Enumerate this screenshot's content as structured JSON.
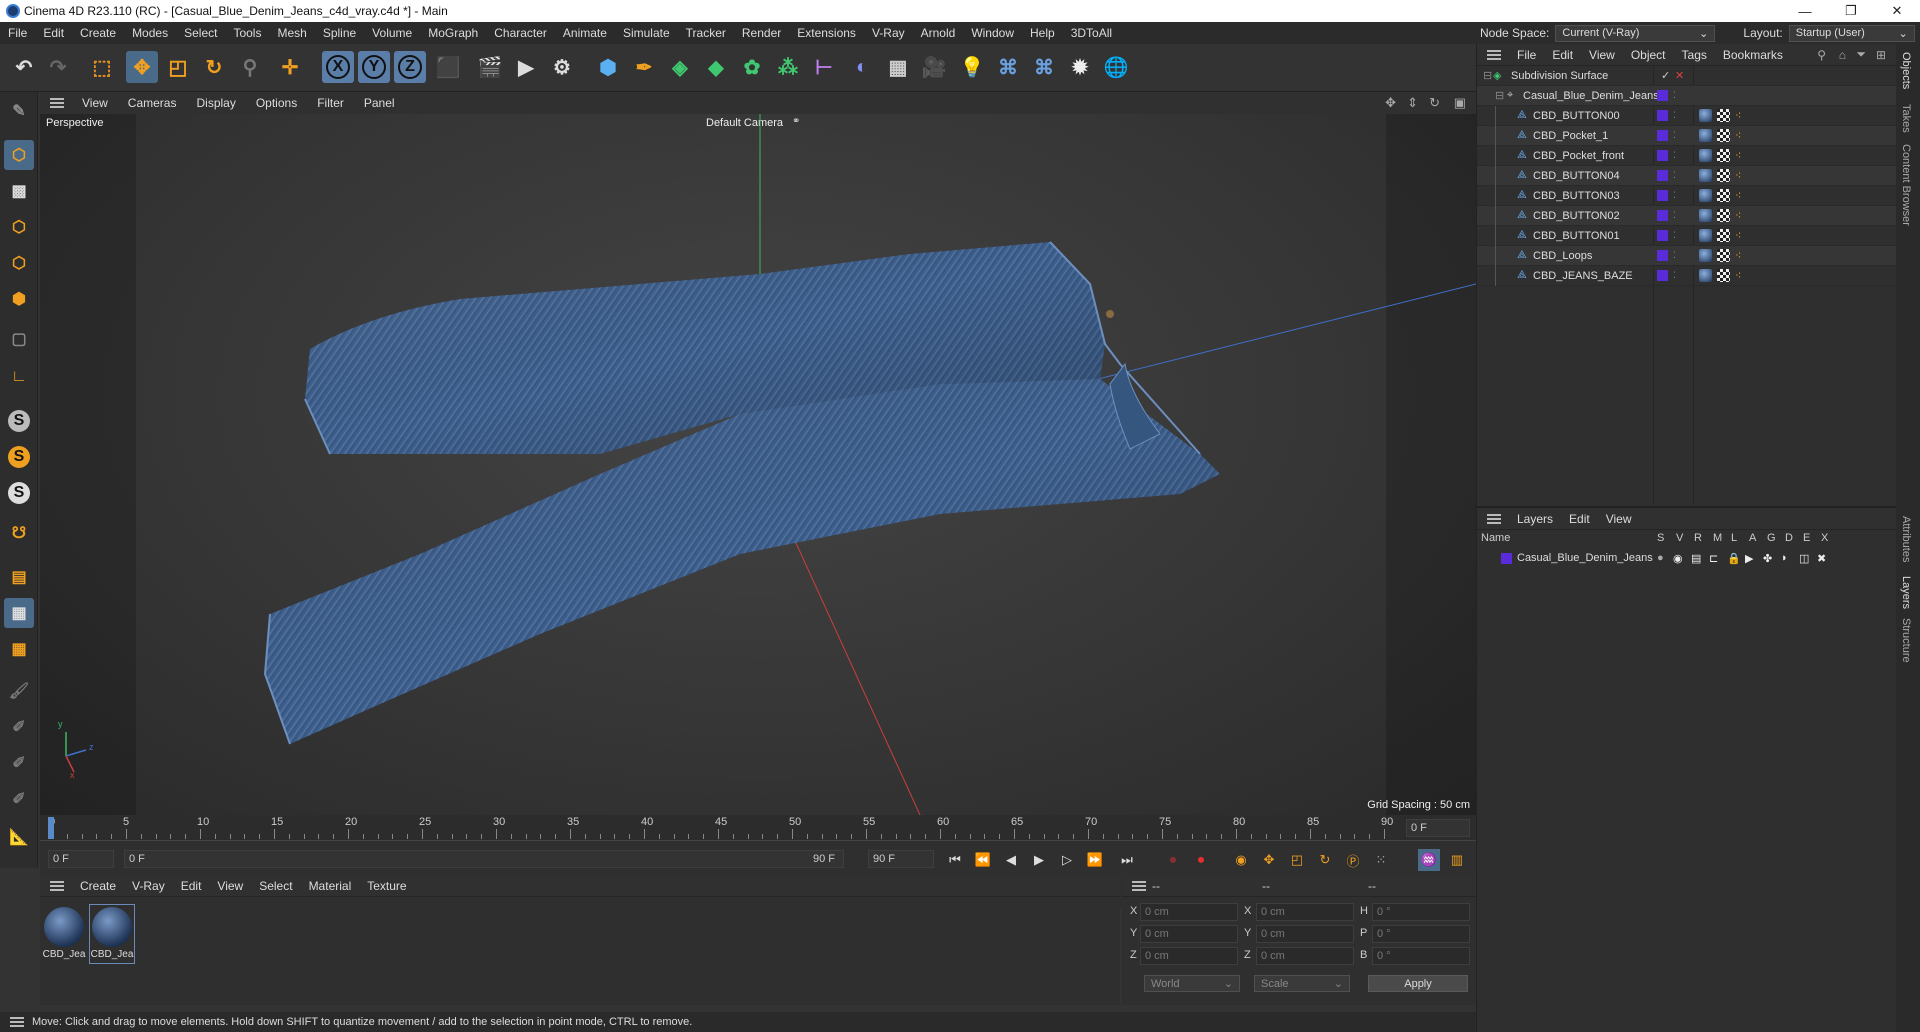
{
  "window": {
    "title": "Cinema 4D R23.110 (RC) - [Casual_Blue_Denim_Jeans_c4d_vray.c4d *] - Main",
    "minimize": "—",
    "restore": "❐",
    "close": "✕"
  },
  "menubar": {
    "items": [
      "File",
      "Edit",
      "Create",
      "Modes",
      "Select",
      "Tools",
      "Mesh",
      "Spline",
      "Volume",
      "MoGraph",
      "Character",
      "Animate",
      "Simulate",
      "Tracker",
      "Render",
      "Extensions",
      "V-Ray",
      "Arnold",
      "Window",
      "Help",
      "3DToAll"
    ],
    "node_space_label": "Node Space:",
    "node_space_value": "Current (V-Ray)",
    "layout_label": "Layout:",
    "layout_value": "Startup (User)"
  },
  "toolbar": {
    "axis_x": "X",
    "axis_y": "Y",
    "axis_z": "Z"
  },
  "viewport": {
    "menu": [
      "View",
      "Cameras",
      "Display",
      "Options",
      "Filter",
      "Panel"
    ],
    "view_name": "Perspective",
    "camera_name": "Default Camera",
    "grid_spacing": "Grid Spacing : 50 cm",
    "axis_y": "y",
    "axis_z": "z",
    "axis_x": "x",
    "accent_colors": {
      "x_axis": "#c84040",
      "y_axis": "#3cb860",
      "z_axis": "#4070c8"
    }
  },
  "timeline": {
    "ticks": [
      "0",
      "5",
      "10",
      "15",
      "20",
      "25",
      "30",
      "35",
      "40",
      "45",
      "50",
      "55",
      "60",
      "65",
      "70",
      "75",
      "80",
      "85",
      "90"
    ],
    "current_frame_display": "0 F",
    "start_frame": "0 F",
    "range_start": "0 F",
    "range_end": "90 F",
    "end_frame": "90 F"
  },
  "materials": {
    "menu": [
      "Create",
      "V-Ray",
      "Edit",
      "View",
      "Select",
      "Material",
      "Texture"
    ],
    "items": [
      {
        "label": "CBD_Jea"
      },
      {
        "label": "CBD_Jea"
      }
    ]
  },
  "coordinates": {
    "headers": [
      "--",
      "--",
      "--"
    ],
    "rows": [
      {
        "a_label": "X",
        "a_value": "0 cm",
        "b_label": "X",
        "b_value": "0 cm",
        "c_label": "H",
        "c_value": "0 °"
      },
      {
        "a_label": "Y",
        "a_value": "0 cm",
        "b_label": "Y",
        "b_value": "0 cm",
        "c_label": "P",
        "c_value": "0 °"
      },
      {
        "a_label": "Z",
        "a_value": "0 cm",
        "b_label": "Z",
        "b_value": "0 cm",
        "c_label": "B",
        "c_value": "0 °"
      }
    ],
    "space": "World",
    "mode": "Scale",
    "apply": "Apply"
  },
  "status": {
    "text": "Move: Click and drag to move elements. Hold down SHIFT to quantize movement / add to the selection in point mode, CTRL to remove."
  },
  "objects": {
    "menu": [
      "File",
      "Edit",
      "View",
      "Object",
      "Tags",
      "Bookmarks"
    ],
    "root": "Subdivision Surface",
    "group": "Casual_Blue_Denim_Jeans",
    "children": [
      "CBD_BUTTON00",
      "CBD_Pocket_1",
      "CBD_Pocket_front",
      "CBD_BUTTON04",
      "CBD_BUTTON03",
      "CBD_BUTTON02",
      "CBD_BUTTON01",
      "CBD_Loops",
      "CBD_JEANS_BAZE"
    ],
    "layer_color": "#5a2bd8"
  },
  "layers": {
    "menu": [
      "Layers",
      "Edit",
      "View"
    ],
    "name_header": "Name",
    "flags": [
      "S",
      "V",
      "R",
      "M",
      "L",
      "A",
      "G",
      "D",
      "E",
      "X"
    ],
    "rows": [
      {
        "name": "Casual_Blue_Denim_Jeans"
      }
    ]
  },
  "side_tabs": [
    "Objects",
    "Takes",
    "Content Browser",
    "Attributes",
    "Layers",
    "Structure"
  ]
}
